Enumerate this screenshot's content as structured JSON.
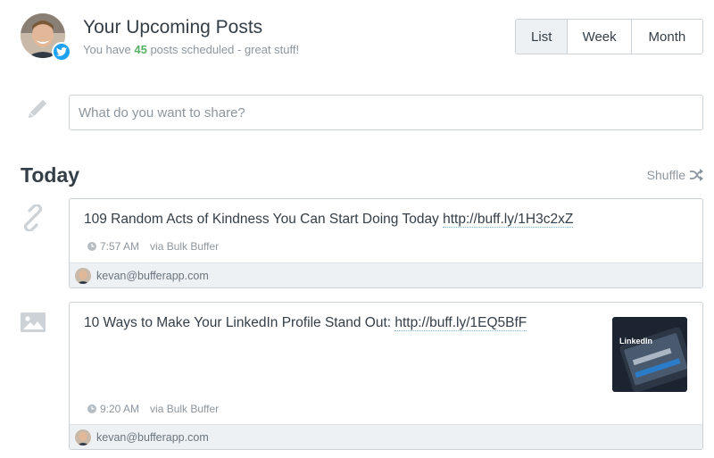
{
  "header": {
    "title": "Your Upcoming Posts",
    "subtitle_prefix": "You have ",
    "post_count": "45",
    "subtitle_suffix": " posts scheduled - great stuff!",
    "network_icon": "twitter-icon",
    "network_color": "#1da1f2"
  },
  "view_toggle": {
    "options": [
      "List",
      "Week",
      "Month"
    ],
    "active": "List"
  },
  "composer": {
    "placeholder": "What do you want to share?"
  },
  "day": {
    "title": "Today",
    "shuffle_label": "Shuffle"
  },
  "posts": [
    {
      "type_icon": "link-icon",
      "text": "109 Random Acts of Kindness You Can Start Doing Today ",
      "link": "http://buff.ly/1H3c2xZ",
      "time": "7:57 AM",
      "via": "via Bulk Buffer",
      "account": "kevan@bufferapp.com"
    },
    {
      "type_icon": "image-icon",
      "text": "10 Ways to Make Your LinkedIn Profile Stand Out: ",
      "link": "http://buff.ly/1EQ5BfF",
      "time": "9:20 AM",
      "via": "via Bulk Buffer",
      "account": "kevan@bufferapp.com",
      "thumbnail_label": "LinkedIn"
    }
  ],
  "colors": {
    "accent_green": "#56b265",
    "text": "#343e47",
    "muted": "#8d969e",
    "border": "#ccd2d6",
    "footer_bg": "#eef1f4"
  }
}
